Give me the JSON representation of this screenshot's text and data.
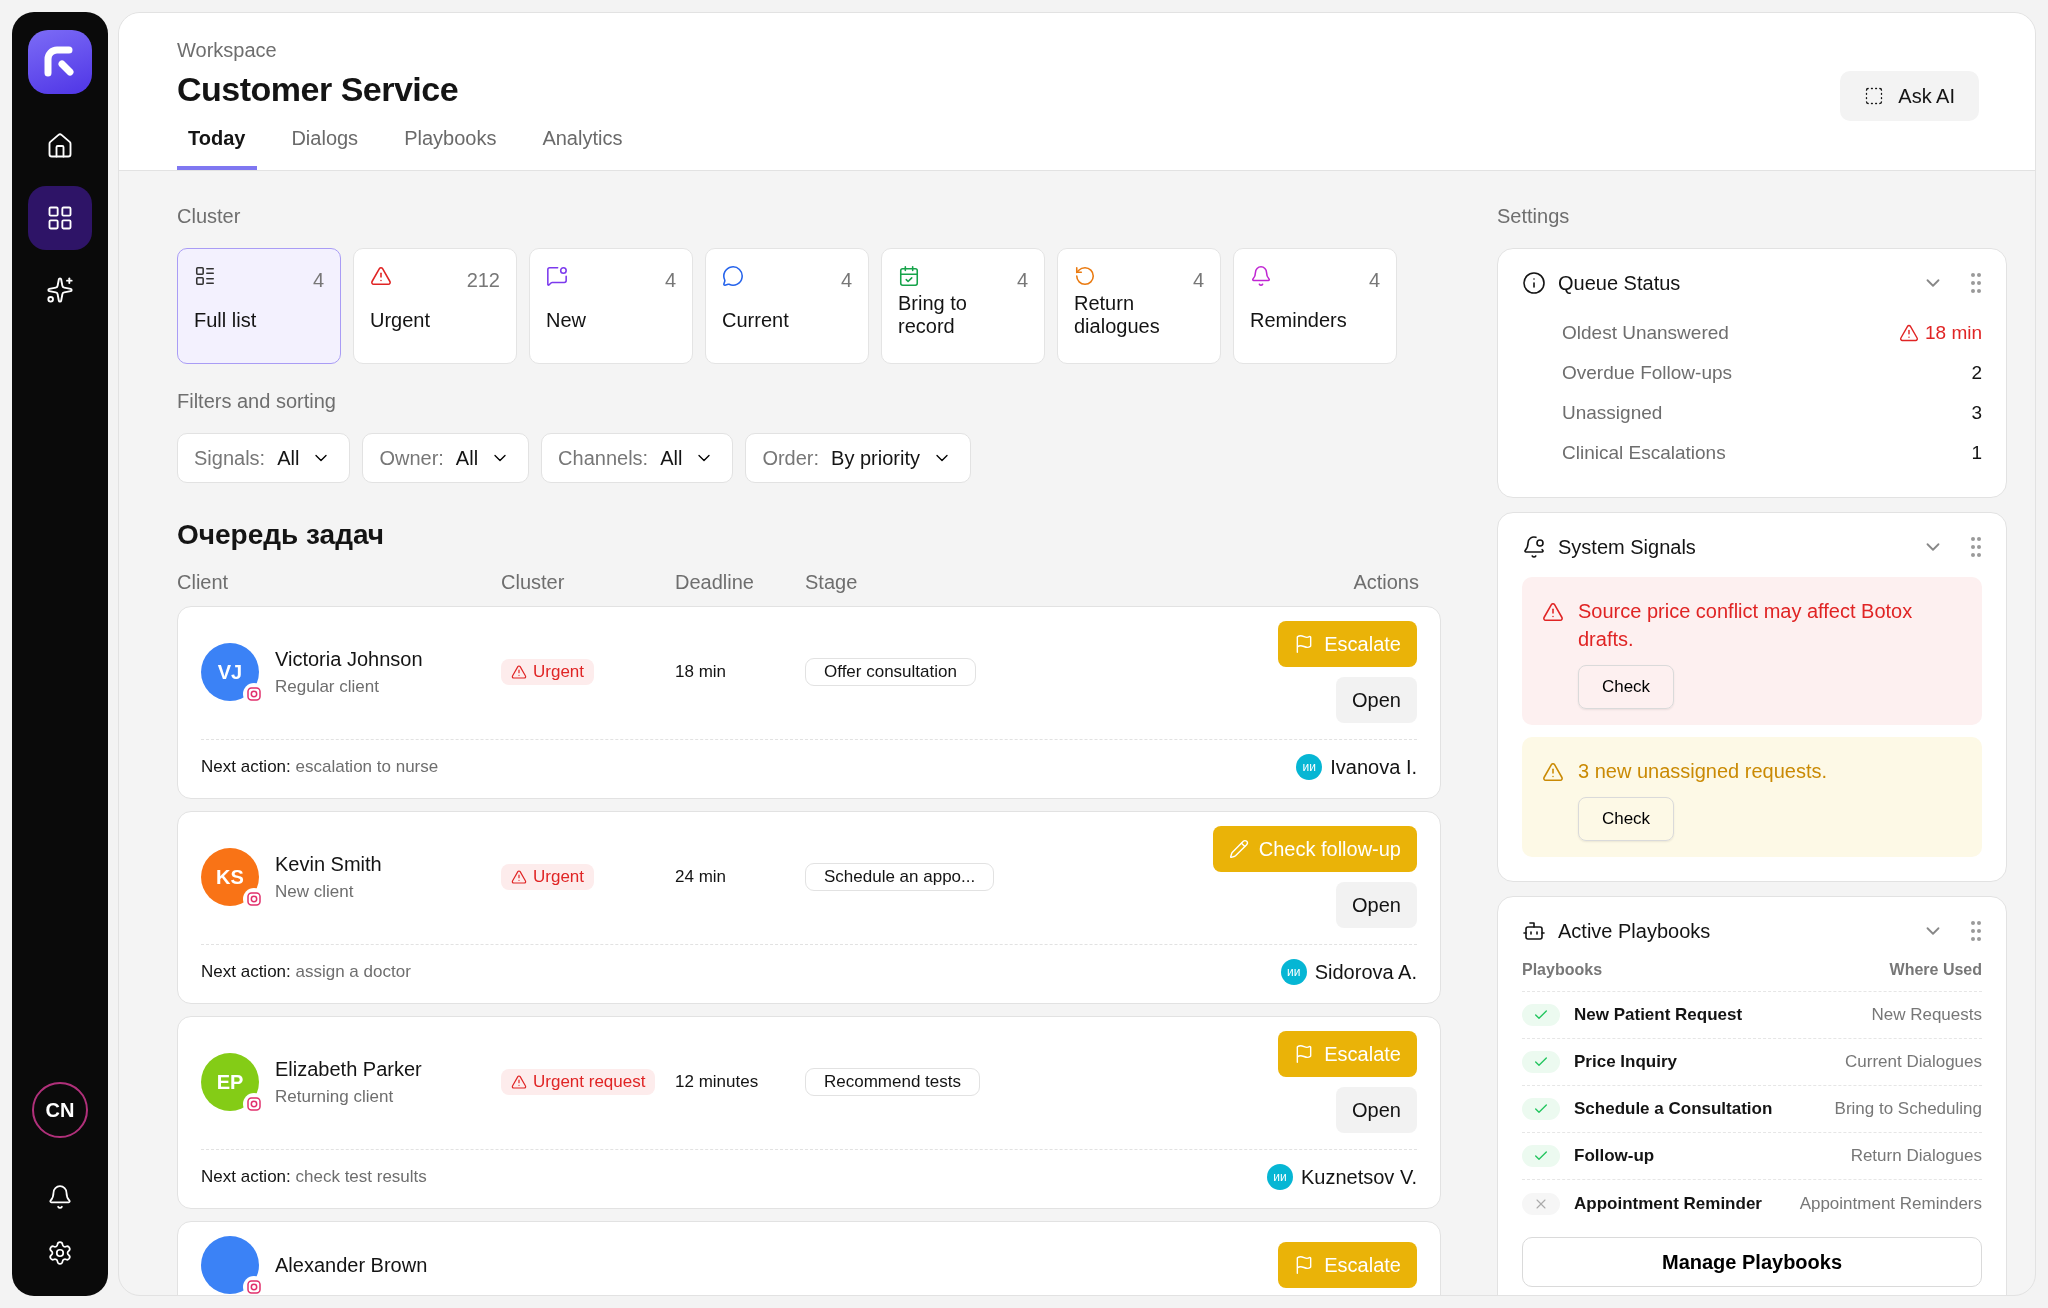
{
  "sidebar": {
    "nav": [
      {
        "kind": "home",
        "selected": false
      },
      {
        "kind": "grid",
        "selected": true
      },
      {
        "kind": "sparkle",
        "selected": false
      }
    ],
    "user": "CN",
    "bottom": [
      {
        "kind": "bell"
      },
      {
        "kind": "settings"
      }
    ]
  },
  "header": {
    "breadcrumb": "Workspace",
    "title": "Customer Service",
    "ask_ai": "Ask AI",
    "tabs": [
      {
        "label": "Today",
        "selected": true
      },
      {
        "label": "Dialogs",
        "selected": false
      },
      {
        "label": "Playbooks",
        "selected": false
      },
      {
        "label": "Analytics",
        "selected": false
      }
    ]
  },
  "cluster": {
    "label": "Cluster",
    "cards": [
      {
        "kind": "list",
        "label": "Full list",
        "count": "4",
        "selected": true
      },
      {
        "kind": "urgent",
        "label": "Urgent",
        "count": "212",
        "selected": false
      },
      {
        "kind": "new",
        "label": "New",
        "count": "4",
        "selected": false
      },
      {
        "kind": "current",
        "label": "Current",
        "count": "4",
        "selected": false
      },
      {
        "kind": "record",
        "label": "Bring to record",
        "count": "4",
        "selected": false
      },
      {
        "kind": "return",
        "label": "Return dialogues",
        "count": "4",
        "selected": false
      },
      {
        "kind": "reminders",
        "label": "Reminders",
        "count": "4",
        "selected": false
      }
    ]
  },
  "filters": {
    "label": "Filters and sorting",
    "items": [
      {
        "label": "Signals:",
        "value": "All"
      },
      {
        "label": "Owner:",
        "value": "All"
      },
      {
        "label": "Channels:",
        "value": "All"
      },
      {
        "label": "Order:",
        "value": "By priority"
      }
    ]
  },
  "queue": {
    "title": "Очередь задач",
    "columns": [
      "Client",
      "Cluster",
      "Deadline",
      "Stage",
      "Actions"
    ],
    "rows": [
      {
        "initials": "VJ",
        "color": "#3b82f6",
        "name": "Victoria Johnson",
        "subtitle": "Regular client",
        "cluster": "Urgent",
        "deadline": "18 min",
        "stage": "Offer consultation",
        "actions": [
          {
            "kind": "escalate",
            "label": "Escalate"
          },
          {
            "kind": "open",
            "label": "Open"
          }
        ],
        "next_label": "Next action:",
        "next_action": "escalation to nurse",
        "owner_initials": "ии",
        "owner": "Ivanova I."
      },
      {
        "initials": "KS",
        "color": "#f97316",
        "name": "Kevin Smith",
        "subtitle": "New client",
        "cluster": "Urgent",
        "deadline": "24 min",
        "stage": "Schedule an appo...",
        "actions": [
          {
            "kind": "followup",
            "label": "Check follow-up"
          },
          {
            "kind": "open",
            "label": "Open"
          }
        ],
        "next_label": "Next action:",
        "next_action": "assign a doctor",
        "owner_initials": "ии",
        "owner": "Sidorova A."
      },
      {
        "initials": "EP",
        "color": "#84cc16",
        "name": "Elizabeth Parker",
        "subtitle": "Returning client",
        "cluster": "Urgent request",
        "deadline": "12 minutes",
        "stage": "Recommend tests",
        "actions": [
          {
            "kind": "escalate",
            "label": "Escalate"
          },
          {
            "kind": "open",
            "label": "Open"
          }
        ],
        "next_label": "Next action:",
        "next_action": "check test results",
        "owner_initials": "ии",
        "owner": "Kuznetsov V."
      },
      {
        "color": "#3b82f6",
        "name": "Alexander Brown",
        "actions": [
          {
            "kind": "escalate",
            "label": "Escalate"
          }
        ]
      }
    ]
  },
  "settings": {
    "label": "Settings",
    "queue_status": {
      "title": "Queue Status",
      "rows": [
        {
          "label": "Oldest Unanswered",
          "value": "18 min",
          "kind": "alert"
        },
        {
          "label": "Overdue Follow-ups",
          "value": "2",
          "kind": "plain"
        },
        {
          "label": "Unassigned",
          "value": "3",
          "kind": "plain"
        },
        {
          "label": "Clinical Escalations",
          "value": "1",
          "kind": "plain"
        }
      ]
    },
    "system_signals": {
      "title": "System Signals",
      "alerts": [
        {
          "kind": "error",
          "text": "Source price conflict may affect Botox drafts.",
          "button": "Check"
        },
        {
          "kind": "warning",
          "text": "3 new unassigned requests.",
          "button": "Check"
        }
      ]
    },
    "playbooks": {
      "title": "Active Playbooks",
      "columns": [
        "Playbooks",
        "Where Used"
      ],
      "rows": [
        {
          "name": "New Patient Request",
          "used": "New Requests",
          "on": true
        },
        {
          "name": "Price Inquiry",
          "used": "Current Dialogues",
          "on": true
        },
        {
          "name": "Schedule a Consultation",
          "used": "Bring to Scheduling",
          "on": true
        },
        {
          "name": "Follow-up",
          "used": "Return Dialogues",
          "on": true
        },
        {
          "name": "Appointment Reminder",
          "used": "Appointment Reminders",
          "on": false
        }
      ],
      "button": "Manage Playbooks"
    }
  }
}
